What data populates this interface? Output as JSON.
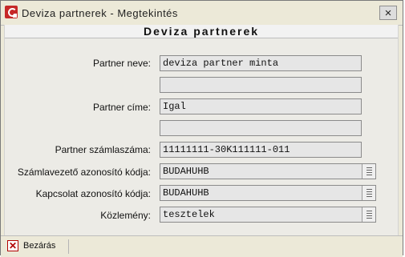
{
  "window": {
    "title": "Deviza partnerek - Megtekintés",
    "close_glyph": "×"
  },
  "panel": {
    "header": "Deviza partnerek"
  },
  "form": {
    "partner_name_label": "Partner neve:",
    "partner_name_value": "deviza partner minta",
    "partner_name_line2": "",
    "partner_address_label": "Partner címe:",
    "partner_address_value": "Igal",
    "partner_address_line2": "",
    "account_number_label": "Partner számlaszáma:",
    "account_number_value": "11111111-30K111111-011",
    "account_manager_label": "Számlavezető azonosító kódja:",
    "account_manager_value": "BUDAHUHB",
    "connection_code_label": "Kapcsolat azonosító kódja:",
    "connection_code_value": "BUDAHUHB",
    "notice_label": "Közlemény:",
    "notice_value": "tesztelek"
  },
  "footer": {
    "close_label": "Bezárás",
    "close_icon_glyph": "✕"
  },
  "icons": {
    "app": "app-logo-icon",
    "close": "close-icon",
    "dropdown": "list-icon",
    "footer_close": "close-icon"
  }
}
